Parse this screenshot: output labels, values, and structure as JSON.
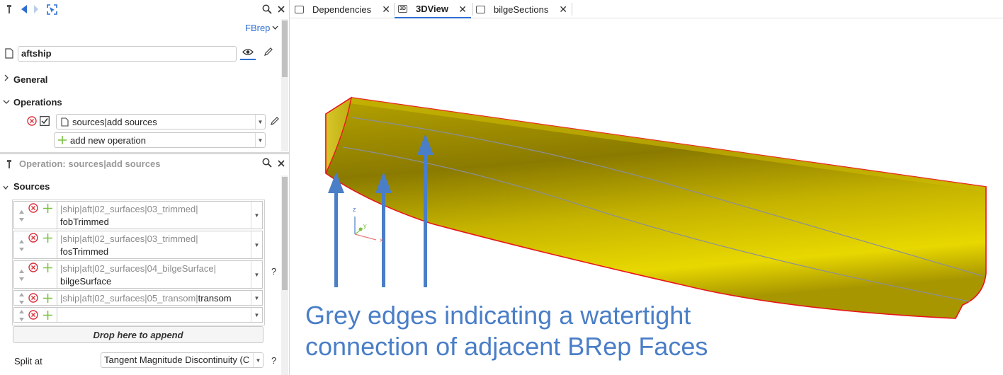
{
  "top_panel": {
    "type_label": "FBrep",
    "object_name": "aftship",
    "sections": {
      "general": "General",
      "operations": "Operations"
    },
    "operation_item": "sources|add sources",
    "add_operation": "add new operation"
  },
  "bottom_panel": {
    "title": "Operation: sources|add sources",
    "sources_label": "Sources",
    "sources": [
      {
        "path": "|ship|aft|02_surfaces|03_trimmed|",
        "value": "fobTrimmed"
      },
      {
        "path": "|ship|aft|02_surfaces|03_trimmed|",
        "value": "fosTrimmed"
      },
      {
        "path": "|ship|aft|02_surfaces|04_bilgeSurface|",
        "value": "bilgeSurface"
      },
      {
        "path": "|ship|aft|02_surfaces|05_transom|",
        "value": "transom"
      },
      {
        "path": "",
        "value": ""
      }
    ],
    "drop_label": "Drop here to append",
    "help": "?",
    "split_label": "Split at",
    "split_value": "Tangent Magnitude Discontinuity (C"
  },
  "tabs": [
    {
      "label": "Dependencies",
      "icon": "DEP"
    },
    {
      "label": "3DView",
      "icon": "3D"
    },
    {
      "label": "bilgeSections",
      "icon": "<>"
    }
  ],
  "viewport": {
    "annotation_line1": "Grey edges indicating a watertight",
    "annotation_line2": "connection of adjacent BRep Faces",
    "axis_z": "z",
    "axis_y": "y",
    "axis_x": "x"
  },
  "colors": {
    "accent": "#2e6fd1",
    "annotation": "#4a7ec7",
    "hull": "#c8b400",
    "hull_outline": "#e8161b",
    "error_icon": "#d9313a",
    "add_icon": "#7cc142"
  }
}
